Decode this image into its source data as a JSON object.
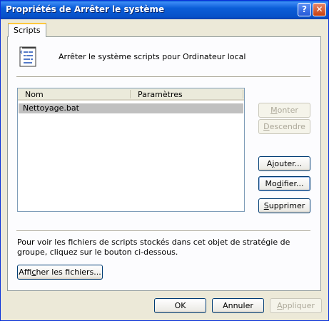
{
  "window": {
    "title": "Propriétés de Arrêter le système",
    "help_glyph": "?",
    "close_glyph": "✕"
  },
  "tabs": [
    {
      "label": "Scripts"
    }
  ],
  "header": {
    "text": "Arrêter le système scripts pour Ordinateur local",
    "icon": "script-document-icon"
  },
  "list": {
    "columns": [
      "Nom",
      "Paramètres"
    ],
    "rows": [
      {
        "name": "Nettoyage.bat",
        "params": ""
      }
    ]
  },
  "side_buttons": {
    "up_prefix": "M",
    "up_rest": "onter",
    "down_prefix": "D",
    "down_rest": "escendre",
    "add_prefix": "A",
    "add_u": "j",
    "add_rest": "outer...",
    "edit_prefix": "Mo",
    "edit_u": "d",
    "edit_rest": "ifier...",
    "delete_u": "S",
    "delete_rest": "upprimer"
  },
  "info_text": "Pour voir les fichiers de scripts stockés dans cet objet de stratégie de groupe, cliquez sur le bouton ci-dessous.",
  "show_files": {
    "prefix": "Affi",
    "u": "c",
    "rest": "her les fichiers..."
  },
  "footer": {
    "ok": "OK",
    "cancel": "Annuler",
    "apply_u": "A",
    "apply_rest": "ppliquer"
  }
}
